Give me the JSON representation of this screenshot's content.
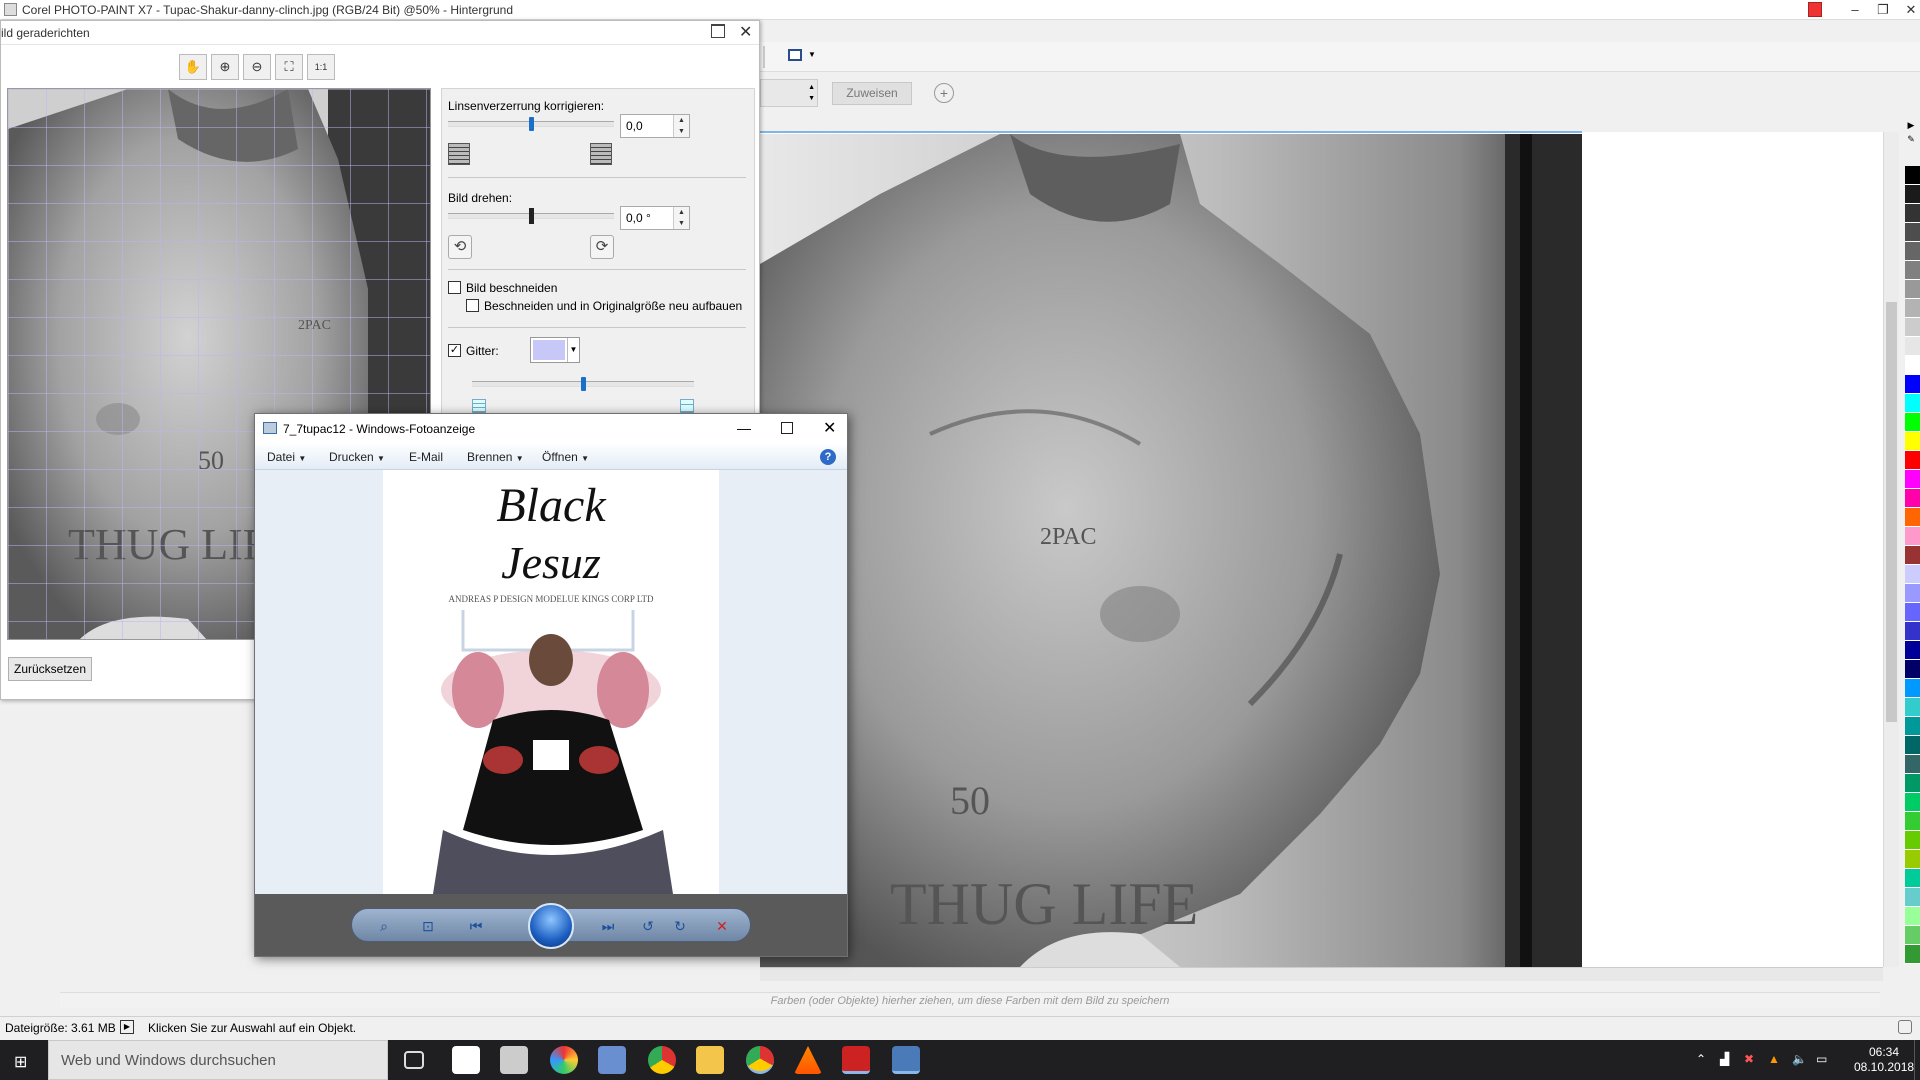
{
  "main_window": {
    "title": "Corel PHOTO-PAINT X7 - Tupac-Shakur-danny-clinch.jpg (RGB/24 Bit) @50% - Hintergrund",
    "assign_button": "Zuweisen",
    "color_hint": "Farben (oder Objekte) hierher ziehen, um diese Farben mit dem Bild zu speichern"
  },
  "status_bar": {
    "file_size": "Dateigröße: 3.61 MB",
    "hint": "Klicken Sie zur Auswahl auf ein Objekt."
  },
  "straighten_dialog": {
    "title": "ild geraderichten",
    "lens_label": "Linsenverzerrung korrigieren:",
    "lens_value": "0,0",
    "lens_level": 0.5,
    "rotate_label": "Bild drehen:",
    "rotate_value": "0,0 °",
    "rotate_level": 0.5,
    "crop_label": "Bild beschneiden",
    "crop_checked": false,
    "crop_resize_label": "Beschneiden und in Originalgröße neu aufbauen",
    "crop_resize_checked": false,
    "grid_label": "Gitter:",
    "grid_checked": true,
    "grid_color": "#c8c8f8",
    "grid_level": 0.5,
    "reset_button": "Zurücksetzen"
  },
  "photo_viewer": {
    "title": "7_7tupac12 - Windows-Fotoanzeige",
    "menu": {
      "file": "Datei",
      "print": "Drucken",
      "email": "E-Mail",
      "burn": "Brennen",
      "open": "Öffnen"
    },
    "image_text": {
      "line1": "Black",
      "line2": "Jesuz",
      "credit": "ANDREAS P DESIGN MODELUE KINGS CORP LTD"
    }
  },
  "taskbar": {
    "search_placeholder": "Web und Windows durchsuchen",
    "time": "06:34",
    "date": "08.10.2018"
  },
  "palette_colors": [
    "#000000",
    "#1a1a1a",
    "#333333",
    "#4d4d4d",
    "#666666",
    "#808080",
    "#999999",
    "#b3b3b3",
    "#cccccc",
    "#e6e6e6",
    "#ffffff",
    "#0000ff",
    "#00ffff",
    "#00ff00",
    "#ffff00",
    "#ff0000",
    "#ff00ff",
    "#ff00aa",
    "#ff6600",
    "#ff99cc",
    "#993333",
    "#ccccff",
    "#9999ff",
    "#6666ff",
    "#3333cc",
    "#000099",
    "#000066",
    "#0099ff",
    "#33cccc",
    "#009999",
    "#006666",
    "#336666",
    "#009966",
    "#00cc66",
    "#33cc33",
    "#66cc00",
    "#99cc00",
    "#00cc99",
    "#66cccc",
    "#99ff99",
    "#66cc66",
    "#339933"
  ]
}
